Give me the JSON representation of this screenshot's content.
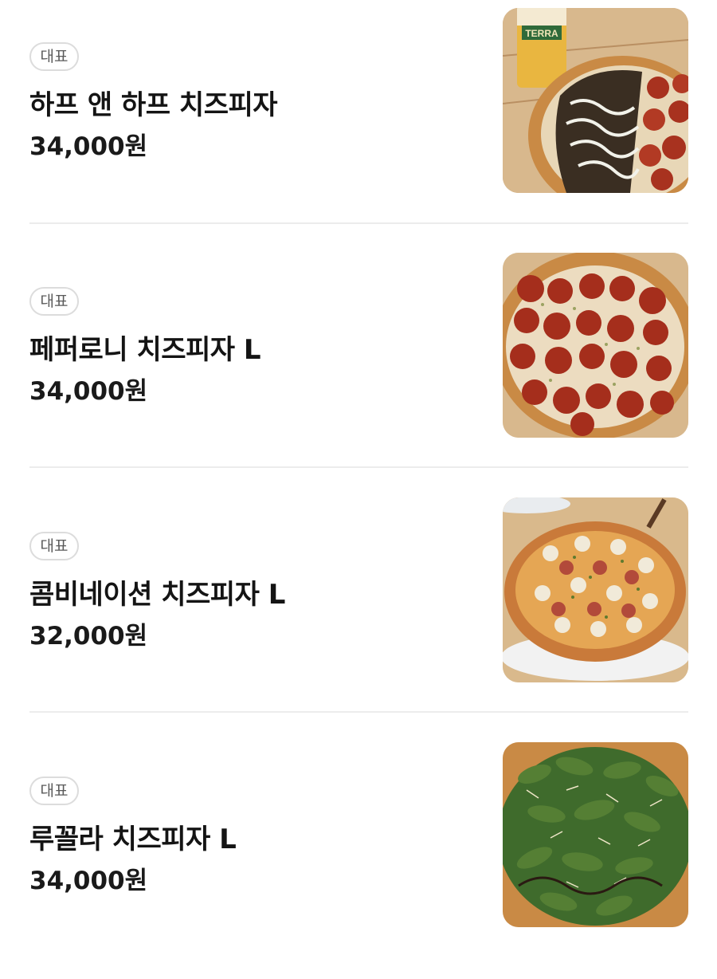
{
  "menu": {
    "items": [
      {
        "badge": "대표",
        "name": "하프 앤 하프 치즈피자",
        "price": "34,000원",
        "image": "half-and-half-pizza-photo"
      },
      {
        "badge": "대표",
        "name": "페퍼로니 치즈피자 L",
        "price": "34,000원",
        "image": "pepperoni-pizza-photo"
      },
      {
        "badge": "대표",
        "name": "콤비네이션 치즈피자 L",
        "price": "32,000원",
        "image": "combination-pizza-photo"
      },
      {
        "badge": "대표",
        "name": "루꼴라 치즈피자 L",
        "price": "34,000원",
        "image": "arugula-pizza-photo"
      }
    ]
  },
  "photo_text": {
    "beer_glass_brand": "TERRA"
  },
  "colors": {
    "background": "#ffffff",
    "badge_border": "#dcdcdc",
    "badge_text": "#5a5a5a",
    "title_text": "#141414",
    "divider": "#ececec"
  }
}
